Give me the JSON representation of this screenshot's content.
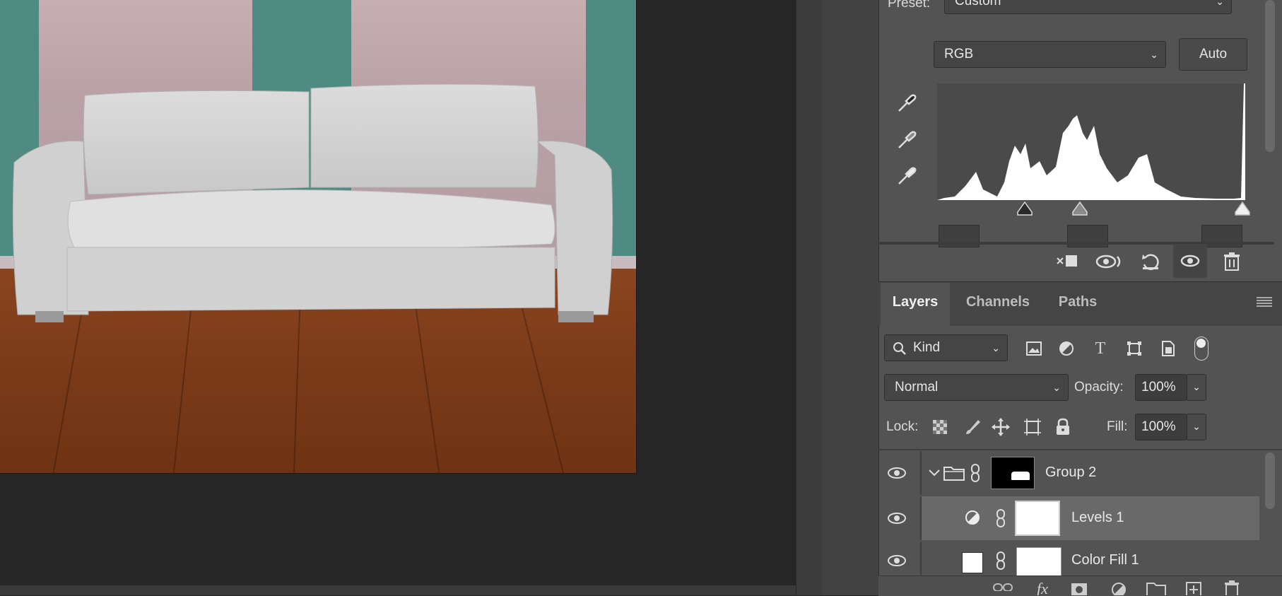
{
  "properties": {
    "preset_label": "Preset:",
    "preset_value": "Custom",
    "channel_value": "RGB",
    "auto_label": "Auto"
  },
  "layers_panel": {
    "tabs": [
      "Layers",
      "Channels",
      "Paths"
    ],
    "active_tab": "Layers",
    "filter_kind": "Kind",
    "blend_mode": "Normal",
    "opacity_label": "Opacity:",
    "opacity_value": "100%",
    "lock_label": "Lock:",
    "fill_label": "Fill:",
    "fill_value": "100%",
    "layers": [
      {
        "name": "Group 2",
        "type": "group",
        "selected": false
      },
      {
        "name": "Levels 1",
        "type": "adjustment",
        "selected": true
      },
      {
        "name": "Color Fill 1",
        "type": "fill",
        "selected": false
      }
    ]
  },
  "colors": {
    "panel_bg": "#535353",
    "selected_row": "#696969",
    "canvas_bg": "#262626"
  }
}
